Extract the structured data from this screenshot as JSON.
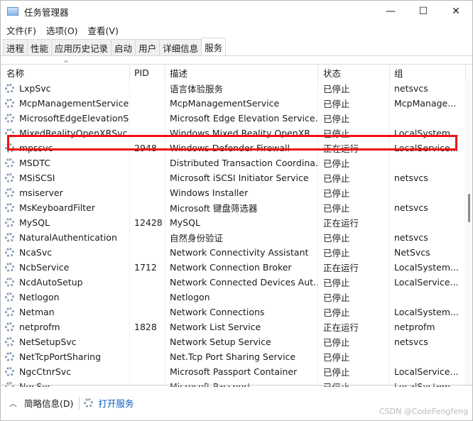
{
  "window": {
    "title": "任务管理器",
    "minimize": "—",
    "maximize": "☐",
    "close": "✕"
  },
  "menu": [
    "文件(F)",
    "选项(O)",
    "查看(V)"
  ],
  "tabs": [
    "进程",
    "性能",
    "应用历史记录",
    "启动",
    "用户",
    "详细信息",
    "服务"
  ],
  "active_tab": "服务",
  "columns": [
    "名称",
    "PID",
    "描述",
    "状态",
    "组"
  ],
  "rows": [
    [
      "LxpSvc",
      "",
      "语言体验服务",
      "已停止",
      "netsvcs"
    ],
    [
      "McpManagementService",
      "",
      "McpManagementService",
      "已停止",
      "McpManage..."
    ],
    [
      "MicrosoftEdgeElevationS...",
      "",
      "Microsoft Edge Elevation Service...",
      "已停止",
      ""
    ],
    [
      "MixedRealityOpenXRSvc",
      "",
      "Windows Mixed Reality OpenXR ...",
      "已停止",
      "LocalSystem..."
    ],
    [
      "mpssvc",
      "2948",
      "Windows Defender Firewall",
      "正在运行",
      "LocalService..."
    ],
    [
      "MSDTC",
      "",
      "Distributed Transaction Coordina...",
      "已停止",
      ""
    ],
    [
      "MSiSCSI",
      "",
      "Microsoft iSCSI Initiator Service",
      "已停止",
      "netsvcs"
    ],
    [
      "msiserver",
      "",
      "Windows Installer",
      "已停止",
      ""
    ],
    [
      "MsKeyboardFilter",
      "",
      "Microsoft 键盘筛选器",
      "已停止",
      "netsvcs"
    ],
    [
      "MySQL",
      "12428",
      "MySQL",
      "正在运行",
      ""
    ],
    [
      "NaturalAuthentication",
      "",
      "自然身份验证",
      "已停止",
      "netsvcs"
    ],
    [
      "NcaSvc",
      "",
      "Network Connectivity Assistant",
      "已停止",
      "NetSvcs"
    ],
    [
      "NcbService",
      "1712",
      "Network Connection Broker",
      "正在运行",
      "LocalSystem..."
    ],
    [
      "NcdAutoSetup",
      "",
      "Network Connected Devices Aut...",
      "已停止",
      "LocalService..."
    ],
    [
      "Netlogon",
      "",
      "Netlogon",
      "已停止",
      ""
    ],
    [
      "Netman",
      "",
      "Network Connections",
      "已停止",
      "LocalSystem..."
    ],
    [
      "netprofm",
      "1828",
      "Network List Service",
      "正在运行",
      "netprofm"
    ],
    [
      "NetSetupSvc",
      "",
      "Network Setup Service",
      "已停止",
      "netsvcs"
    ],
    [
      "NetTcpPortSharing",
      "",
      "Net.Tcp Port Sharing Service",
      "已停止",
      ""
    ],
    [
      "NgcCtnrSvc",
      "",
      "Microsoft Passport Container",
      "已停止",
      "LocalService..."
    ],
    [
      "NgcSvc",
      "",
      "Microsoft Passport",
      "已停止",
      "LocalSystem..."
    ]
  ],
  "highlighted_row": "MySQL",
  "highlight_color": "#f01010",
  "footer": {
    "summary": "简略信息(D)",
    "open_services": "打开服务"
  },
  "watermark": "CSDN @CodeFengfeng"
}
